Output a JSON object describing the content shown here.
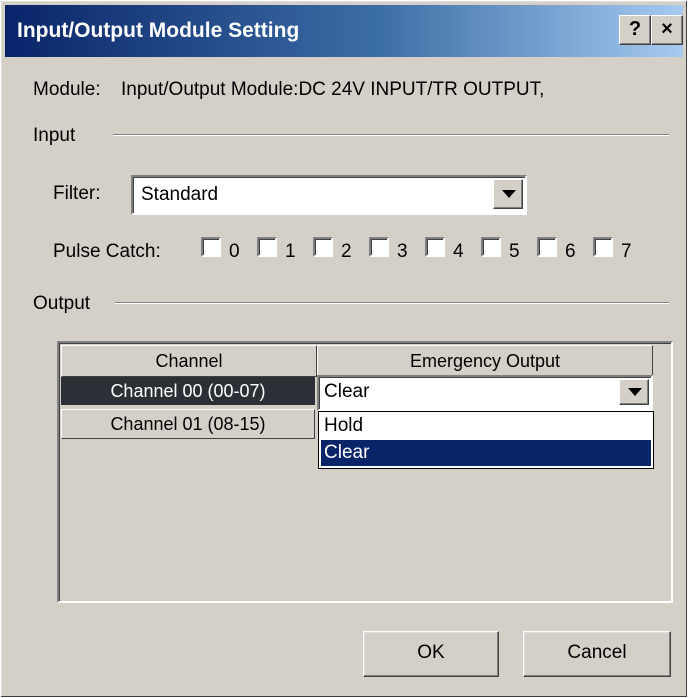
{
  "window": {
    "title": "Input/Output Module Setting",
    "help_label": "?",
    "close_label": "×"
  },
  "module": {
    "label": "Module:",
    "value": "Input/Output Module:DC 24V INPUT/TR OUTPUT,"
  },
  "input": {
    "group_label": "Input",
    "filter_label": "Filter:",
    "filter_value": "Standard",
    "pulse_catch_label": "Pulse Catch:",
    "pulse_catch_bits": [
      "0",
      "1",
      "2",
      "3",
      "4",
      "5",
      "6",
      "7"
    ]
  },
  "output": {
    "group_label": "Output",
    "columns": [
      "Channel",
      "Emergency Output"
    ],
    "rows": [
      {
        "channel": "Channel 00 (00-07)",
        "emergency": "Clear"
      },
      {
        "channel": "Channel 01 (08-15)",
        "emergency": ""
      }
    ],
    "dropdown_options": [
      "Hold",
      "Clear"
    ],
    "dropdown_selected": "Clear"
  },
  "buttons": {
    "ok": "OK",
    "cancel": "Cancel"
  },
  "colors": {
    "dialog_bg": "#d4d0c8",
    "title_gradient_start": "#0a246a",
    "title_gradient_end": "#a6caf0",
    "selected_row": "#2c2f36",
    "selected_option": "#0a246a"
  }
}
